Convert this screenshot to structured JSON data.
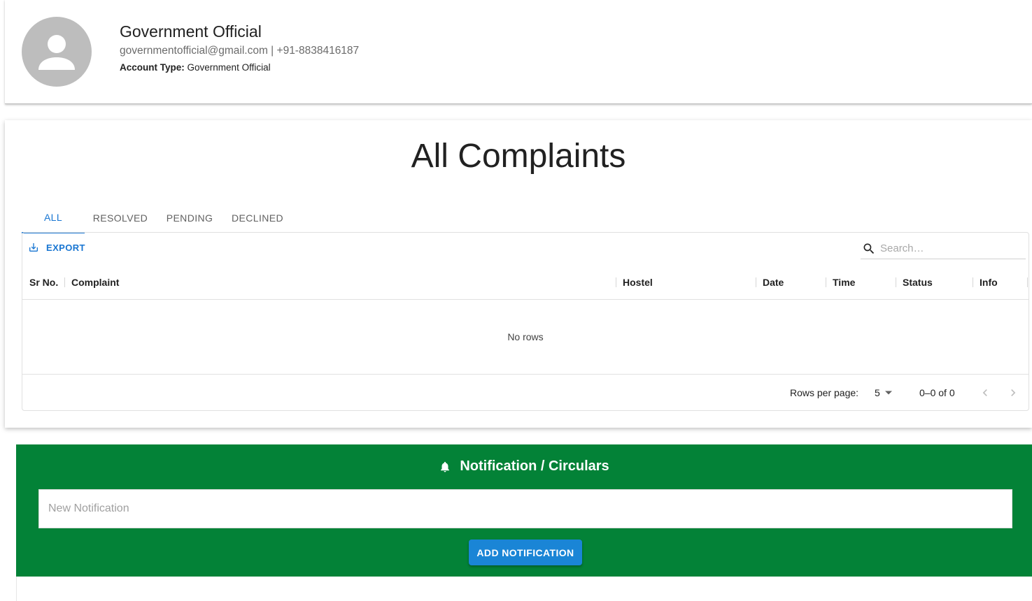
{
  "profile": {
    "name": "Government Official",
    "email": "governmentofficial@gmail.com",
    "separator": " | ",
    "phone": "+91-8838416187",
    "account_type_label": "Account Type:",
    "account_type_value": "Government Official"
  },
  "complaints": {
    "title": "All Complaints",
    "tabs": [
      {
        "label": "ALL",
        "active": true
      },
      {
        "label": "RESOLVED",
        "active": false
      },
      {
        "label": "PENDING",
        "active": false
      },
      {
        "label": "DECLINED",
        "active": false
      }
    ],
    "toolbar": {
      "export_label": "EXPORT",
      "search_placeholder": "Search…"
    },
    "columns": [
      "Sr No.",
      "Complaint",
      "Hostel",
      "Date",
      "Time",
      "Status",
      "Info"
    ],
    "empty_text": "No rows",
    "footer": {
      "rows_per_page_label": "Rows per page:",
      "rows_per_page_value": "5",
      "range_text": "0–0 of 0"
    }
  },
  "notifications": {
    "title": "Notification / Circulars",
    "input_placeholder": "New Notification",
    "input_value": "",
    "add_button_label": "ADD NOTIFICATION"
  },
  "colors": {
    "accent": "#1976d2",
    "panel_green": "#038237",
    "button_blue": "#1a85d6",
    "avatar_gray": "#bdbdbd"
  },
  "icons": {
    "avatar": "person-icon",
    "export": "download-icon",
    "search": "search-icon",
    "dropdown": "caret-down-icon",
    "prev": "chevron-left-icon",
    "next": "chevron-right-icon",
    "notification": "bell-icon"
  }
}
